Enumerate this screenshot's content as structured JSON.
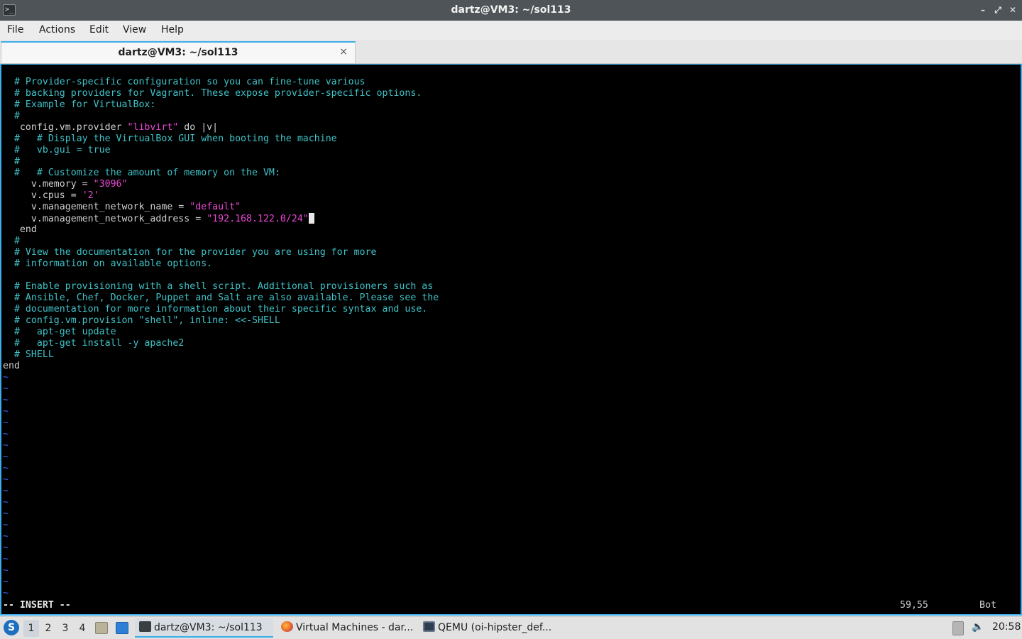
{
  "window": {
    "title": "dartz@VM3: ~/sol113",
    "controls": {
      "minimize": "–",
      "maximize": "⤢",
      "close": "✕"
    }
  },
  "menu": [
    "File",
    "Actions",
    "Edit",
    "View",
    "Help"
  ],
  "tab": {
    "label": "dartz@VM3: ~/sol113",
    "close": "×"
  },
  "editor": {
    "lines": [
      [
        {
          "t": "  # Provider-specific configuration so you can fine-tune various",
          "c": "cmt"
        }
      ],
      [
        {
          "t": "  # backing providers for Vagrant. These expose provider-specific options.",
          "c": "cmt"
        }
      ],
      [
        {
          "t": "  # Example for VirtualBox:",
          "c": "cmt"
        }
      ],
      [
        {
          "t": "  #",
          "c": "cmt"
        }
      ],
      [
        {
          "t": "   config.vm.provider ",
          "c": "kw"
        },
        {
          "t": "\"libvirt\"",
          "c": "str"
        },
        {
          "t": " do |v|",
          "c": "kw"
        }
      ],
      [
        {
          "t": "  #   # Display the VirtualBox GUI when booting the machine",
          "c": "cmt"
        }
      ],
      [
        {
          "t": "  #   vb.gui = true",
          "c": "cmt"
        }
      ],
      [
        {
          "t": "  #",
          "c": "cmt"
        }
      ],
      [
        {
          "t": "  #   # Customize the amount of memory on the VM:",
          "c": "cmt"
        }
      ],
      [
        {
          "t": "     v.memory = ",
          "c": "kw"
        },
        {
          "t": "\"3096\"",
          "c": "str"
        }
      ],
      [
        {
          "t": "     v.cpus = ",
          "c": "kw"
        },
        {
          "t": "'2'",
          "c": "str"
        }
      ],
      [
        {
          "t": "     v.management_network_name = ",
          "c": "kw"
        },
        {
          "t": "\"default\"",
          "c": "str"
        }
      ],
      [
        {
          "t": "     v.management_network_address = ",
          "c": "kw"
        },
        {
          "t": "\"192.168.122.0/24\"",
          "c": "str"
        },
        {
          "t": "",
          "c": "cursor"
        }
      ],
      [
        {
          "t": "   end",
          "c": "kw"
        }
      ],
      [
        {
          "t": "  #",
          "c": "cmt"
        }
      ],
      [
        {
          "t": "  # View the documentation for the provider you are using for more",
          "c": "cmt"
        }
      ],
      [
        {
          "t": "  # information on available options.",
          "c": "cmt"
        }
      ],
      [
        {
          "t": "",
          "c": "kw"
        }
      ],
      [
        {
          "t": "  # Enable provisioning with a shell script. Additional provisioners such as",
          "c": "cmt"
        }
      ],
      [
        {
          "t": "  # Ansible, Chef, Docker, Puppet and Salt are also available. Please see the",
          "c": "cmt"
        }
      ],
      [
        {
          "t": "  # documentation for more information about their specific syntax and use.",
          "c": "cmt"
        }
      ],
      [
        {
          "t": "  # config.vm.provision \"shell\", inline: <<-SHELL",
          "c": "cmt"
        }
      ],
      [
        {
          "t": "  #   apt-get update",
          "c": "cmt"
        }
      ],
      [
        {
          "t": "  #   apt-get install -y apache2",
          "c": "cmt"
        }
      ],
      [
        {
          "t": "  # SHELL",
          "c": "cmt"
        }
      ],
      [
        {
          "t": "end",
          "c": "kw"
        }
      ]
    ],
    "tilde_count": 20,
    "tilde_char": "~",
    "status": {
      "mode": "-- INSERT --",
      "position": "59,55",
      "scroll": "Bot"
    },
    "colors": {
      "comment": "#3fc2c7",
      "string": "#ec47d6",
      "text": "#d0d0d0",
      "tilde": "#3b67f0"
    }
  },
  "taskbar": {
    "desktops": [
      "1",
      "2",
      "3",
      "4"
    ],
    "active_desktop": "1",
    "tasks": [
      {
        "label": "dartz@VM3: ~/sol113",
        "icon": "terminal-icon",
        "active": true
      },
      {
        "label": "Virtual Machines - dar...",
        "icon": "firefox-icon",
        "active": false
      },
      {
        "label": "QEMU (oi-hipster_def...",
        "icon": "monitor-icon",
        "active": false
      }
    ],
    "clock": "20:58"
  }
}
